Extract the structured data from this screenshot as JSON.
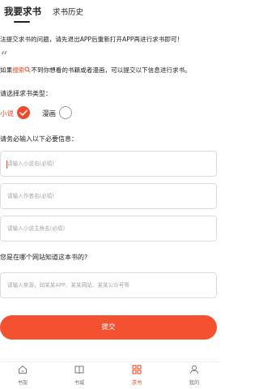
{
  "tabs": {
    "active": "我要求书",
    "other": "求书历史"
  },
  "notice": "法提交求书的问题，请先退出APP后重新打开APP再进行求书即可！",
  "hint": {
    "prefix": "如果",
    "accent": "搜索",
    "suffix": "不到你想看的书籍或者漫画，可以提交以下信息进行求书。"
  },
  "type_section": {
    "label": "请选择求书类型：",
    "options": [
      {
        "label": "小说",
        "selected": true
      },
      {
        "label": "漫画",
        "selected": false
      }
    ]
  },
  "info_section": {
    "label": "请务必输入以下必要信息："
  },
  "fields": {
    "book_name": {
      "value": "",
      "placeholder": "请输入小说名(必填)"
    },
    "author": {
      "value": "",
      "placeholder": "请输入作者名(必填)"
    },
    "protagonist": {
      "value": "",
      "placeholder": "请输入小说主角名(必填)"
    },
    "source": {
      "value": "",
      "placeholder": "请输入来源，如某某APP、某某网站、某某公众号等"
    }
  },
  "source_section": {
    "label": "您是在哪个网站知道这本书的?"
  },
  "submit_label": "提交",
  "nav": {
    "items": [
      {
        "label": "书架",
        "icon": "home-icon"
      },
      {
        "label": "书城",
        "icon": "book-icon"
      },
      {
        "label": "求书",
        "icon": "grid-icon",
        "active": true
      },
      {
        "label": "我的",
        "icon": "user-icon"
      }
    ]
  },
  "colors": {
    "accent": "#f04a2c",
    "button": "#f45131"
  }
}
